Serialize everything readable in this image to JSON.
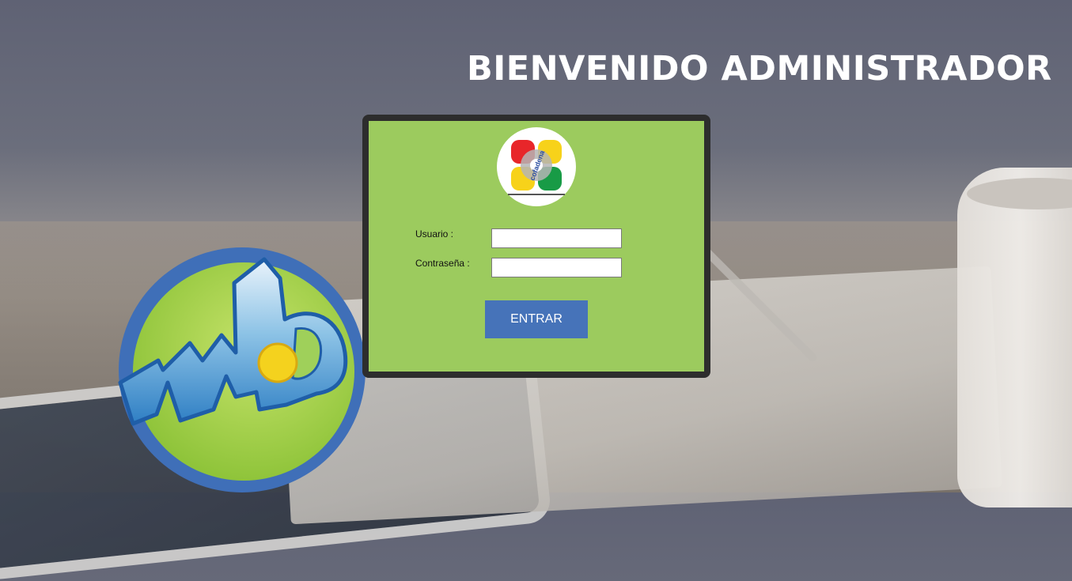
{
  "header": {
    "title": "BIENVENIDO ADMINISTRADOR"
  },
  "brand": {
    "main_logo_icon": "mb-logo-icon",
    "card_logo_icon": "cofadena-logo-icon",
    "card_logo_text": "cofadena"
  },
  "login_form": {
    "username_label": "Usuario :",
    "username_value": "",
    "password_label": "Contraseña :",
    "password_value": "",
    "submit_label": "ENTRAR"
  },
  "colors": {
    "card_background": "#9ccb5e",
    "card_border": "#2d2d2d",
    "button_background": "#4673b9",
    "title_text": "#ffffff"
  }
}
